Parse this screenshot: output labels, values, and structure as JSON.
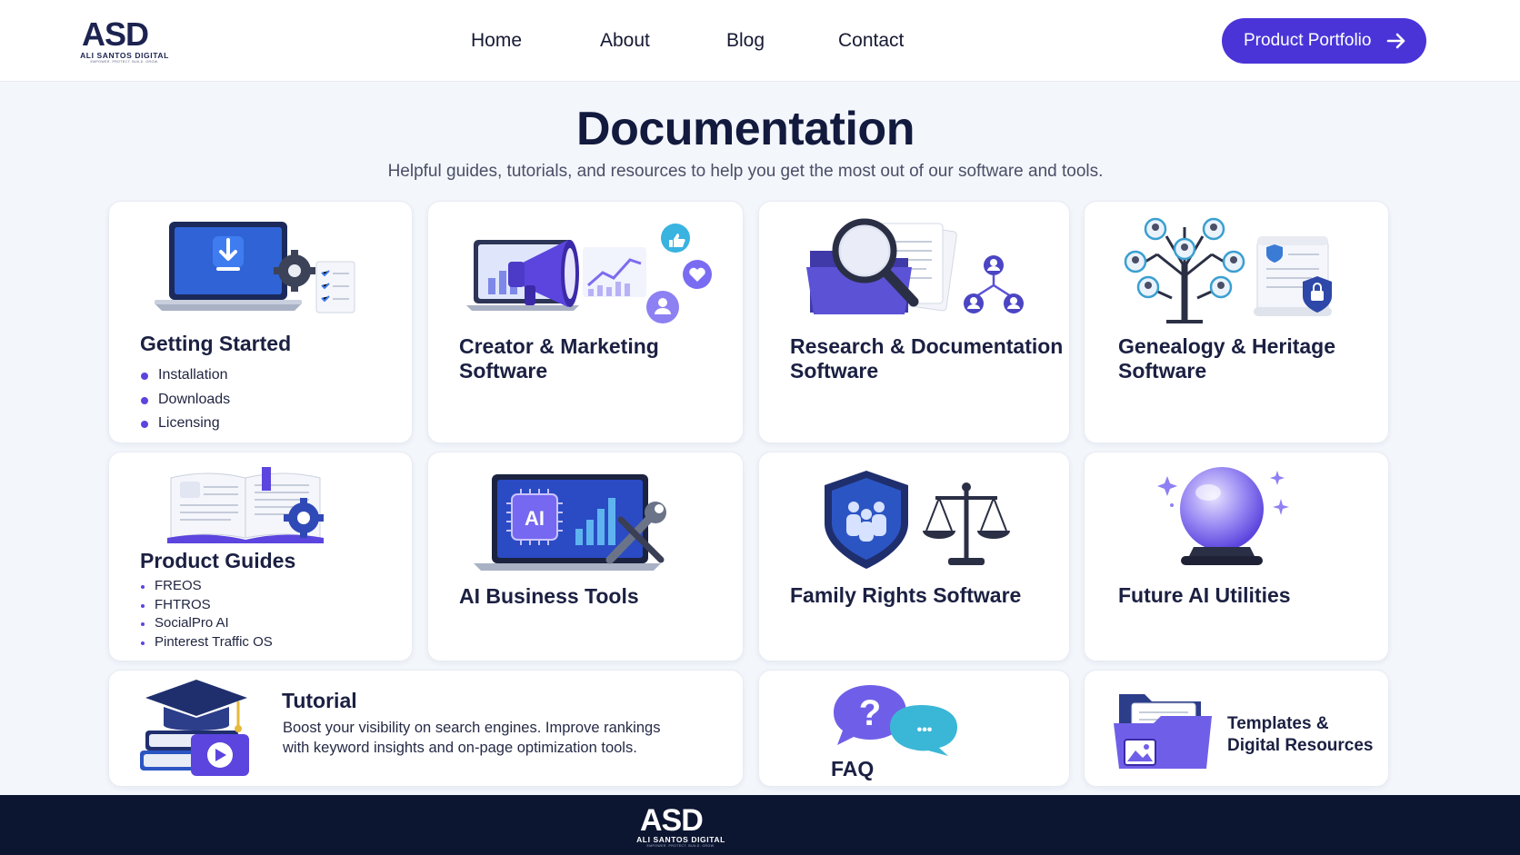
{
  "brand": {
    "logo_letters": "ASD",
    "name": "ALI SANTOS DIGITAL",
    "tagline": "EMPOWER. PROTECT. BUILD. GROW.",
    "accent": "#4a34d8",
    "footer_bg": "#0c1631"
  },
  "nav": {
    "items": [
      {
        "label": "Home"
      },
      {
        "label": "About"
      },
      {
        "label": "Blog"
      },
      {
        "label": "Contact"
      }
    ],
    "cta_label": "Product Portfolio",
    "cta_icon": "arrow-right-icon"
  },
  "page": {
    "title": "Documentation",
    "subtitle": "Helpful guides, tutorials, and resources to help you get the most out of our software and tools."
  },
  "cards": {
    "getting_started": {
      "title": "Getting Started",
      "icon": "laptop-download-icon",
      "items": [
        "Installation",
        "Downloads",
        "Licensing"
      ]
    },
    "creator": {
      "title_1": "Creator & Marketing",
      "title_2": "Software",
      "icon": "megaphone-icon"
    },
    "research": {
      "title_1": "Research & Documentation",
      "title_2": "Software",
      "icon": "magnifier-folder-icon"
    },
    "genealogy": {
      "title_1": "Genealogy & Heritage",
      "title_2": "Software",
      "icon": "family-tree-icon"
    },
    "product_guides": {
      "title": "Product Guides",
      "icon": "open-book-gear-icon",
      "items": [
        "FREOS",
        "FHTROS",
        "SocialPro AI",
        "Pinterest Traffic OS"
      ]
    },
    "ai_business": {
      "title": "AI Business Tools",
      "icon": "ai-chip-laptop-icon",
      "chip_label": "AI"
    },
    "family_rights": {
      "title": "Family Rights Software",
      "icon": "shield-scales-icon"
    },
    "future_ai": {
      "title": "Future AI Utilities",
      "icon": "crystal-ball-icon"
    },
    "tutorial": {
      "title": "Tutorial",
      "icon": "graduation-books-icon",
      "description": "Boost your visibility on search engines. Improve rankings with keyword insights and on-page optimization tools."
    },
    "faq": {
      "title": "FAQ",
      "icon": "chat-bubbles-icon",
      "bubble_mark": "?",
      "bubble_dots": "•••"
    },
    "templates": {
      "title_1": "Templates &",
      "title_2": "Digital Resources",
      "icon": "folder-files-icon"
    }
  }
}
